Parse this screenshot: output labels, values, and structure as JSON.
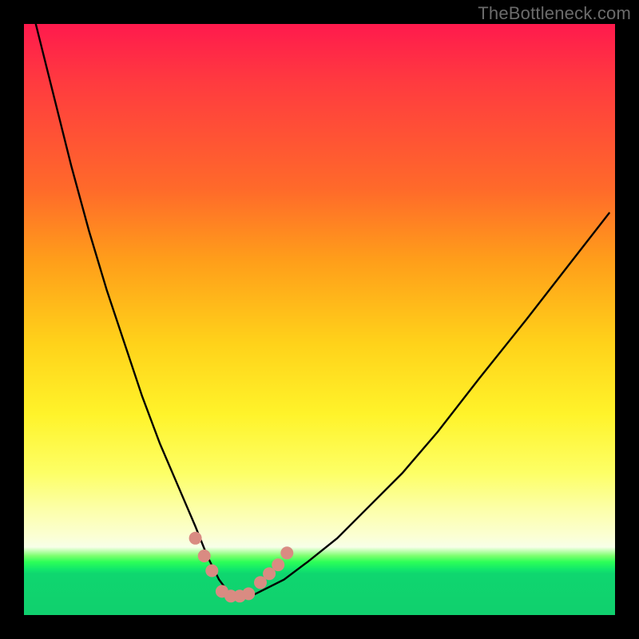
{
  "watermark": "TheBottleneck.com",
  "chart_data": {
    "type": "line",
    "title": "",
    "xlabel": "",
    "ylabel": "",
    "xlim": [
      0,
      100
    ],
    "ylim": [
      0,
      100
    ],
    "grid": false,
    "series": [
      {
        "name": "bottleneck-curve",
        "color": "#000000",
        "x": [
          2,
          5,
          8,
          11,
          14,
          17,
          20,
          23,
          26,
          29,
          31,
          33,
          34.5,
          36,
          38,
          40,
          44,
          48,
          53,
          58,
          64,
          70,
          77,
          85,
          92,
          99
        ],
        "values": [
          100,
          88,
          76,
          65,
          55,
          46,
          37,
          29,
          22,
          15,
          10,
          6,
          4,
          3,
          3,
          4,
          6,
          9,
          13,
          18,
          24,
          31,
          40,
          50,
          59,
          68
        ]
      }
    ],
    "markers": [
      {
        "name": "left-dots",
        "color": "#d98b82",
        "x": [
          29.0,
          30.5,
          31.8
        ],
        "values": [
          13.0,
          10.0,
          7.5
        ]
      },
      {
        "name": "floor-dots",
        "color": "#d98b82",
        "x": [
          33.5,
          35.0,
          36.5,
          38.0
        ],
        "values": [
          4.0,
          3.2,
          3.2,
          3.6
        ]
      },
      {
        "name": "right-dots",
        "color": "#d98b82",
        "x": [
          40.0,
          41.5,
          43.0,
          44.5
        ],
        "values": [
          5.5,
          7.0,
          8.5,
          10.5
        ]
      }
    ]
  }
}
